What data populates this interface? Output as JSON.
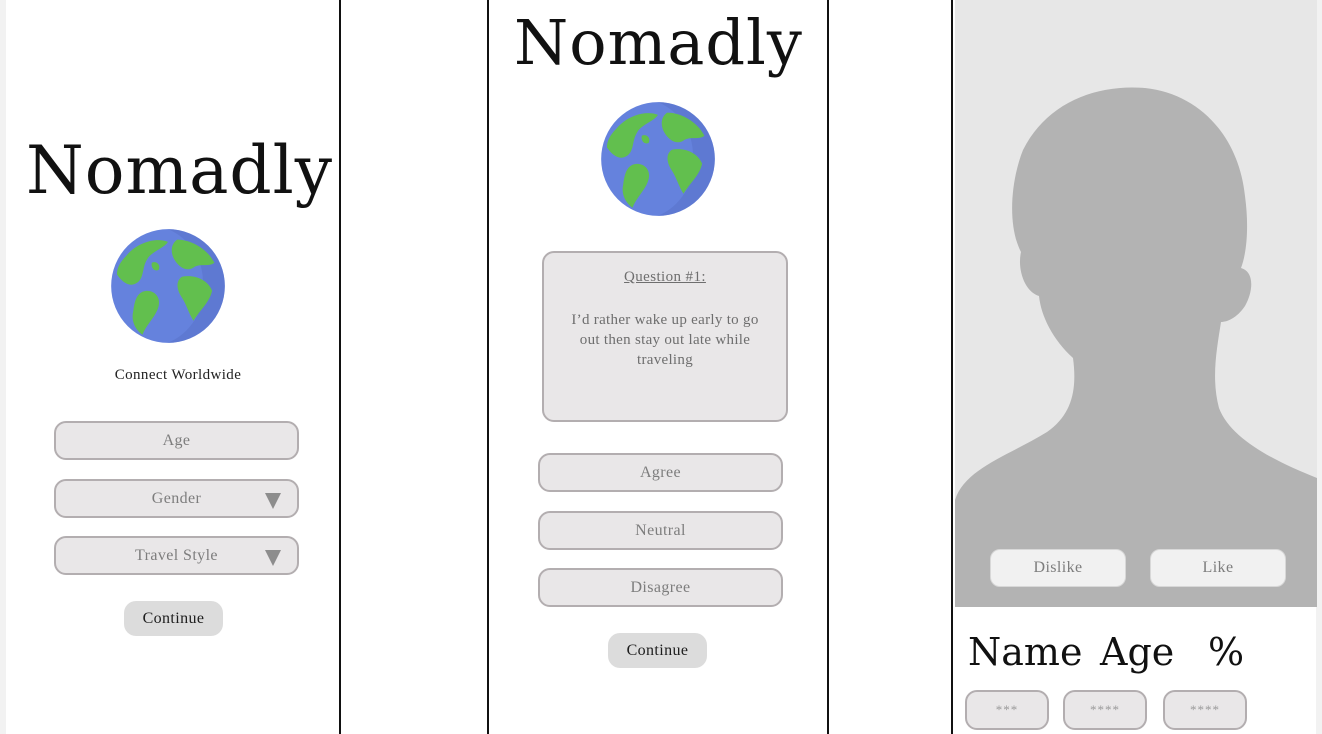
{
  "screen1": {
    "logo": "Nomadly",
    "tagline": "Connect Worldwide",
    "age_placeholder": "Age",
    "gender_placeholder": "Gender",
    "travel_style_placeholder": "Travel Style",
    "continue_label": "Continue"
  },
  "screen2": {
    "logo": "Nomadly",
    "question_title": "Question #1:",
    "question_text": "I’d rather wake up early to go out then stay out late while traveling",
    "options": [
      "Agree",
      "Neutral",
      "Disagree"
    ],
    "continue_label": "Continue"
  },
  "screen3": {
    "dislike_label": "Dislike",
    "like_label": "Like",
    "name_label": "Name",
    "age_label": "Age",
    "match_label": "%",
    "tags": [
      "***",
      "****",
      "****"
    ]
  },
  "colors": {
    "globe_ocean": "#6582dd",
    "globe_land": "#62bf4e",
    "silhouette": "#b3b3b3",
    "photo_background": "#e7e7e7"
  },
  "icons": [
    "globe-icon",
    "dropdown-caret-icon",
    "profile-silhouette"
  ]
}
